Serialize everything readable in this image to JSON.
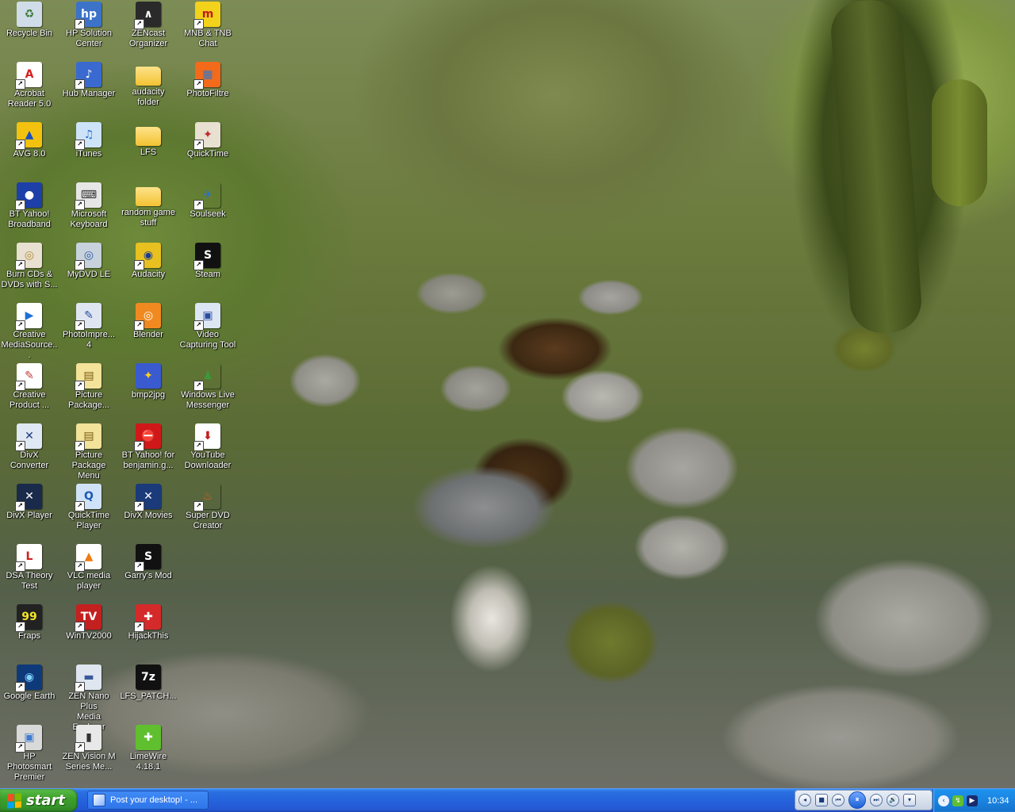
{
  "desktop": {
    "icons": [
      {
        "label": "Recycle Bin",
        "glyph": "♻",
        "bg": "#d0dde8",
        "fg": "#3a7a3a",
        "shortcut": false
      },
      {
        "label": "Acrobat\nReader 5.0",
        "glyph": "A",
        "bg": "#ffffff",
        "fg": "#d42020",
        "shortcut": true
      },
      {
        "label": "AVG 8.0",
        "glyph": "▲",
        "bg": "#f2c20e",
        "fg": "#1a4fbf",
        "shortcut": true
      },
      {
        "label": "BT Yahoo!\nBroadband",
        "glyph": "●",
        "bg": "#1d3fa8",
        "fg": "#ffffff",
        "shortcut": true
      },
      {
        "label": "Burn CDs &\nDVDs with S...",
        "glyph": "◎",
        "bg": "#e8e0d0",
        "fg": "#b08a3a",
        "shortcut": true
      },
      {
        "label": "Creative\nMediaSource...",
        "glyph": "▶",
        "bg": "#ffffff",
        "fg": "#1f6fd6",
        "shortcut": true
      },
      {
        "label": "Creative\nProduct ...",
        "glyph": "✎",
        "bg": "#ffffff",
        "fg": "#c23b3b",
        "shortcut": true
      },
      {
        "label": "DivX\nConverter",
        "glyph": "✕",
        "bg": "#dfe8f3",
        "fg": "#1a3a80",
        "shortcut": true
      },
      {
        "label": "DivX Player",
        "glyph": "✕",
        "bg": "#1a2a4a",
        "fg": "#ffffff",
        "shortcut": true
      },
      {
        "label": "DSA Theory\nTest",
        "glyph": "L",
        "bg": "#ffffff",
        "fg": "#d41c1c",
        "shortcut": true
      },
      {
        "label": "Fraps",
        "glyph": "99",
        "bg": "#222222",
        "fg": "#f2e52a",
        "shortcut": true
      },
      {
        "label": "Google Earth",
        "glyph": "◉",
        "bg": "#0f3a7a",
        "fg": "#7fd3ff",
        "shortcut": true
      },
      {
        "label": "HP Photosmart\nPremier",
        "glyph": "▣",
        "bg": "#d9d9d9",
        "fg": "#3b7bd1",
        "shortcut": true
      },
      {
        "label": "HP Solution\nCenter",
        "glyph": "hp",
        "bg": "#3c73c9",
        "fg": "#ffffff",
        "shortcut": true
      },
      {
        "label": "Hub Manager",
        "glyph": "♪",
        "bg": "#3a6ad0",
        "fg": "#ffffff",
        "shortcut": true
      },
      {
        "label": "iTunes",
        "glyph": "♫",
        "bg": "#cde3f7",
        "fg": "#2a6fcf",
        "shortcut": true
      },
      {
        "label": "Microsoft\nKeyboard",
        "glyph": "⌨",
        "bg": "#e6e6e6",
        "fg": "#333333",
        "shortcut": true
      },
      {
        "label": "MyDVD LE",
        "glyph": "◎",
        "bg": "#c8d2dc",
        "fg": "#2a5aa8",
        "shortcut": true
      },
      {
        "label": "PhotoImpre...\n4",
        "glyph": "✎",
        "bg": "#dfe6f2",
        "fg": "#2a4fa0",
        "shortcut": true
      },
      {
        "label": "Picture\nPackage...",
        "glyph": "▤",
        "bg": "#f2e29a",
        "fg": "#7a5a10",
        "shortcut": true
      },
      {
        "label": "Picture\nPackage Menu",
        "glyph": "▤",
        "bg": "#f2e29a",
        "fg": "#7a5a10",
        "shortcut": true
      },
      {
        "label": "QuickTime\nPlayer",
        "glyph": "Q",
        "bg": "#cfe2f7",
        "fg": "#1c59b5",
        "shortcut": true
      },
      {
        "label": "VLC media\nplayer",
        "glyph": "▲",
        "bg": "#ffffff",
        "fg": "#f07a10",
        "shortcut": true
      },
      {
        "label": "WinTV2000",
        "glyph": "TV",
        "bg": "#c42020",
        "fg": "#ffffff",
        "shortcut": true
      },
      {
        "label": "ZEN Nano Plus\nMedia Explorer",
        "glyph": "▬",
        "bg": "#dfe6f0",
        "fg": "#3a5a9a",
        "shortcut": true
      },
      {
        "label": "ZEN Vision M\nSeries Me...",
        "glyph": "▮",
        "bg": "#e8e8e8",
        "fg": "#333333",
        "shortcut": true
      },
      {
        "label": "ZENcast\nOrganizer",
        "glyph": "∧",
        "bg": "#2a2a2a",
        "fg": "#ffffff",
        "shortcut": true
      },
      {
        "label": "audacity\nfolder",
        "glyph": "",
        "bg": "",
        "fg": "",
        "folder": true,
        "shortcut": false
      },
      {
        "label": "LFS",
        "glyph": "",
        "bg": "",
        "fg": "",
        "folder": true,
        "shortcut": false
      },
      {
        "label": "random game\nstuff",
        "glyph": "",
        "bg": "",
        "fg": "",
        "folder": true,
        "shortcut": false
      },
      {
        "label": "Audacity",
        "glyph": "◉",
        "bg": "#e8c020",
        "fg": "#1a3a90",
        "shortcut": true
      },
      {
        "label": "Blender",
        "glyph": "◎",
        "bg": "#f08a20",
        "fg": "#ffffff",
        "shortcut": true
      },
      {
        "label": "bmp2jpg",
        "glyph": "✦",
        "bg": "#3a5ad0",
        "fg": "#ffd020",
        "shortcut": false
      },
      {
        "label": "BT Yahoo! for\nbenjamin.g...",
        "glyph": "⛔",
        "bg": "#d01818",
        "fg": "#ffffff",
        "shortcut": true
      },
      {
        "label": "DivX Movies",
        "glyph": "✕",
        "bg": "#1a3a7a",
        "fg": "#ffffff",
        "shortcut": true
      },
      {
        "label": "Garry's Mod",
        "glyph": "S",
        "bg": "#111111",
        "fg": "#ffffff",
        "shortcut": true
      },
      {
        "label": "HijackThis",
        "glyph": "✚",
        "bg": "#d42a2a",
        "fg": "#ffffff",
        "shortcut": true
      },
      {
        "label": "LFS_PATCH...",
        "glyph": "7z",
        "bg": "#111111",
        "fg": "#ffffff",
        "shortcut": false
      },
      {
        "label": "LimeWire\n4.18.1",
        "glyph": "✚",
        "bg": "#5fbf2f",
        "fg": "#ffffff",
        "shortcut": false
      },
      {
        "label": "MNB & TNB\nChat",
        "glyph": "m",
        "bg": "#f2d21a",
        "fg": "#c01a1a",
        "shortcut": true
      },
      {
        "label": "PhotoFiltre",
        "glyph": "▦",
        "bg": "#f26a1a",
        "fg": "#2a7ad0",
        "shortcut": true
      },
      {
        "label": "QuickTime",
        "glyph": "✦",
        "bg": "#e8e0d0",
        "fg": "#c02a2a",
        "shortcut": true
      },
      {
        "label": "Soulseek",
        "glyph": "✈",
        "bg": "rgba(0,0,0,0)",
        "fg": "#2a6fd6",
        "shortcut": true
      },
      {
        "label": "Steam",
        "glyph": "S",
        "bg": "#111111",
        "fg": "#ffffff",
        "shortcut": true
      },
      {
        "label": "Video\nCapturing Tool",
        "glyph": "▣",
        "bg": "#dde6f3",
        "fg": "#2a4fa0",
        "shortcut": true
      },
      {
        "label": "Windows Live\nMessenger",
        "glyph": "♟",
        "bg": "rgba(0,0,0,0)",
        "fg": "#3a9a3a",
        "shortcut": true
      },
      {
        "label": "YouTube\nDownloader",
        "glyph": "⬇",
        "bg": "#ffffff",
        "fg": "#c02020",
        "shortcut": true
      },
      {
        "label": "Super DVD\nCreator",
        "glyph": "♨",
        "bg": "rgba(0,0,0,0)",
        "fg": "#f05a1a",
        "shortcut": true
      }
    ]
  },
  "taskbar": {
    "start_label": "start",
    "start_flag_colors": [
      "#f25022",
      "#7fba00",
      "#00a4ef",
      "#ffb900"
    ],
    "window_button": "Post your desktop! - ...",
    "media_controls": {
      "stop": "■",
      "prev": "⏮",
      "pause": "⏸",
      "next": "⏭",
      "volume": "🔊"
    },
    "tray_icons": [
      "back-arrow",
      "network",
      "media-player"
    ],
    "clock": "10:34"
  },
  "colors": {
    "taskbar_blue": "#2563dc",
    "start_green": "#3ea12b",
    "tray_blue": "#1a84e0"
  }
}
